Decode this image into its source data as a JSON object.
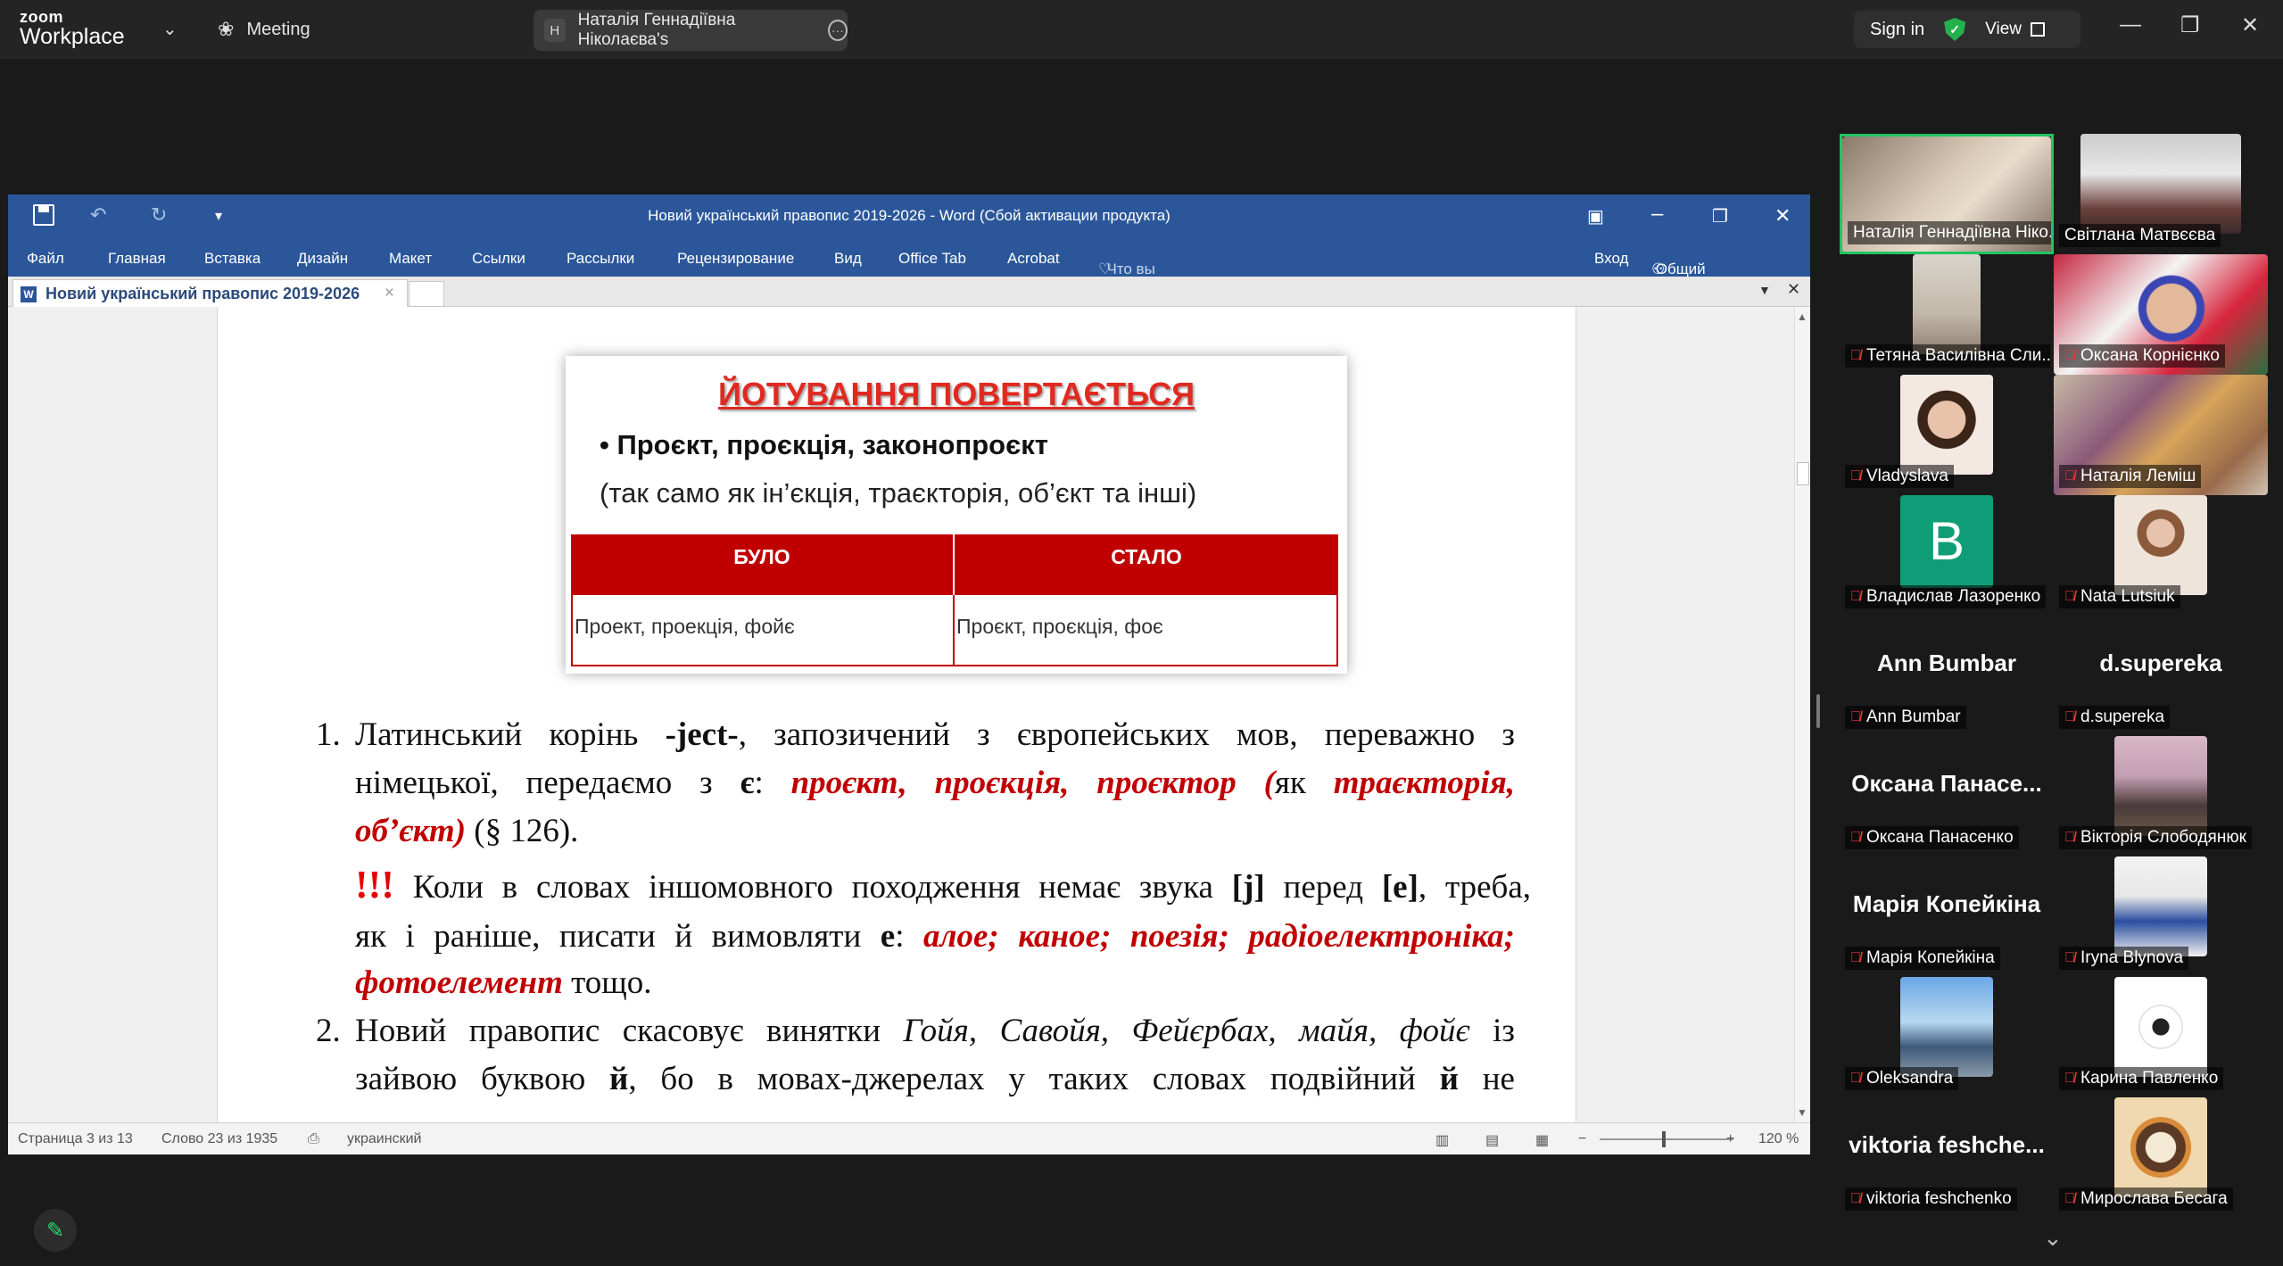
{
  "zoom": {
    "logo_top": "zoom",
    "logo_bottom": "Workplace",
    "meeting_label": "Meeting",
    "share_badge": "H",
    "share_label": "Наталія Геннадіївна Ніколаєва's",
    "sign_in": "Sign in",
    "view": "View",
    "shield_mark": "✓"
  },
  "word": {
    "title": "Новий український правопис 2019-2026 - Word (Сбой активации продукта)",
    "ribbon_tabs": [
      "Файл",
      "Главная",
      "Вставка",
      "Дизайн",
      "Макет",
      "Ссылки",
      "Рассылки",
      "Рецензирование",
      "Вид",
      "Office Tab",
      "Acrobat"
    ],
    "search_placeholder": "Что вы хотите сделать?",
    "login": "Вход",
    "share": "Общий доступ",
    "doc_tab": "Новий український правопис 2019-2026",
    "status": {
      "page": "Страница 3 из 13",
      "words": "Слово 23 из 1935",
      "language": "украинский",
      "zoom": "120 %"
    }
  },
  "slide": {
    "title": "ЙОТУВАННЯ ПОВЕРТАЄТЬСЯ",
    "bullet": "• Проєкт, проєкція, законопроєкт",
    "subtitle": "(так само як ін’єкція, траєкторія, об’єкт та інші)",
    "table": {
      "headers": [
        "БУЛО",
        "СТАЛО"
      ],
      "row": [
        "Проект, проекція, фойє",
        "Проєкт, проєкція, фоє"
      ]
    }
  },
  "document": {
    "item1": {
      "num": "1.",
      "l1_a": "Латинський корінь ",
      "l1_b": "-ject-",
      "l1_c": ", запозичений з європейських мов, переважно з",
      "l2_a": "німецької, передаємо з ",
      "l2_b": "є",
      "l2_c": ": ",
      "l2_d": "проєкт, проєкція, проєктор",
      "l2_e": " (",
      "l2_f": "як ",
      "l2_g": "траєкторія,",
      "l3_a": "об’єкт",
      "l3_b": ")",
      "l3_c": " (§ 126)."
    },
    "note": {
      "excl": "!!!",
      "l1_a": " Коли в словах іншомовного походження немає звука ",
      "l1_b": "[j]",
      "l1_c": " перед ",
      "l1_d": "[е]",
      "l1_e": ", треба,",
      "l2_a": "як і раніше, писати й вимовляти ",
      "l2_b": "е",
      "l2_c": ": ",
      "l2_d": "алое; каное; поезія; радіоелектроніка;",
      "l3_a": "фотоелемент",
      "l3_b": " тощо."
    },
    "item2": {
      "num": "2.",
      "l1_a": "Новий правопис скасовує винятки ",
      "l1_b": "Гойя, Савойя, Фейєрбах, майя, фойє",
      "l1_c": " із",
      "l2_a": "зайвою буквою ",
      "l2_b": "й",
      "l2_c": ", бо в мовах-джерелах у таких словах подвійний ",
      "l2_d": "й",
      "l2_e": " не"
    }
  },
  "participants": [
    {
      "name": "Наталія Геннадіївна Ніко...",
      "active": true
    },
    {
      "name": "Світлана Матвєєва"
    },
    {
      "name": "Тетяна Василівна Сли..."
    },
    {
      "name": "Оксана Корнієнко"
    },
    {
      "name": "Vladyslava"
    },
    {
      "name": "Наталія Леміш"
    },
    {
      "name": "Владислав Лазоренко",
      "initial": "B"
    },
    {
      "name": "Nata Lutsiuk"
    },
    {
      "name": "Ann Bumbar",
      "big": "Ann Bumbar"
    },
    {
      "name": "d.supereka",
      "big": "d.supereka"
    },
    {
      "name": "Оксана Панасенко",
      "big": "Оксана Панасе..."
    },
    {
      "name": "Вікторія Слободянюк"
    },
    {
      "name": "Марія Копейкіна",
      "big": "Марія Копейкіна"
    },
    {
      "name": "Iryna Blynova"
    },
    {
      "name": "Oleksandra"
    },
    {
      "name": "Карина Павленко"
    },
    {
      "name": "viktoria feshchenko",
      "big": "viktoria feshche..."
    },
    {
      "name": "Мирослава Бесага"
    }
  ],
  "colors": {
    "word_blue": "#2b579a",
    "accent_red": "#c00000",
    "active_green": "#21c463"
  }
}
